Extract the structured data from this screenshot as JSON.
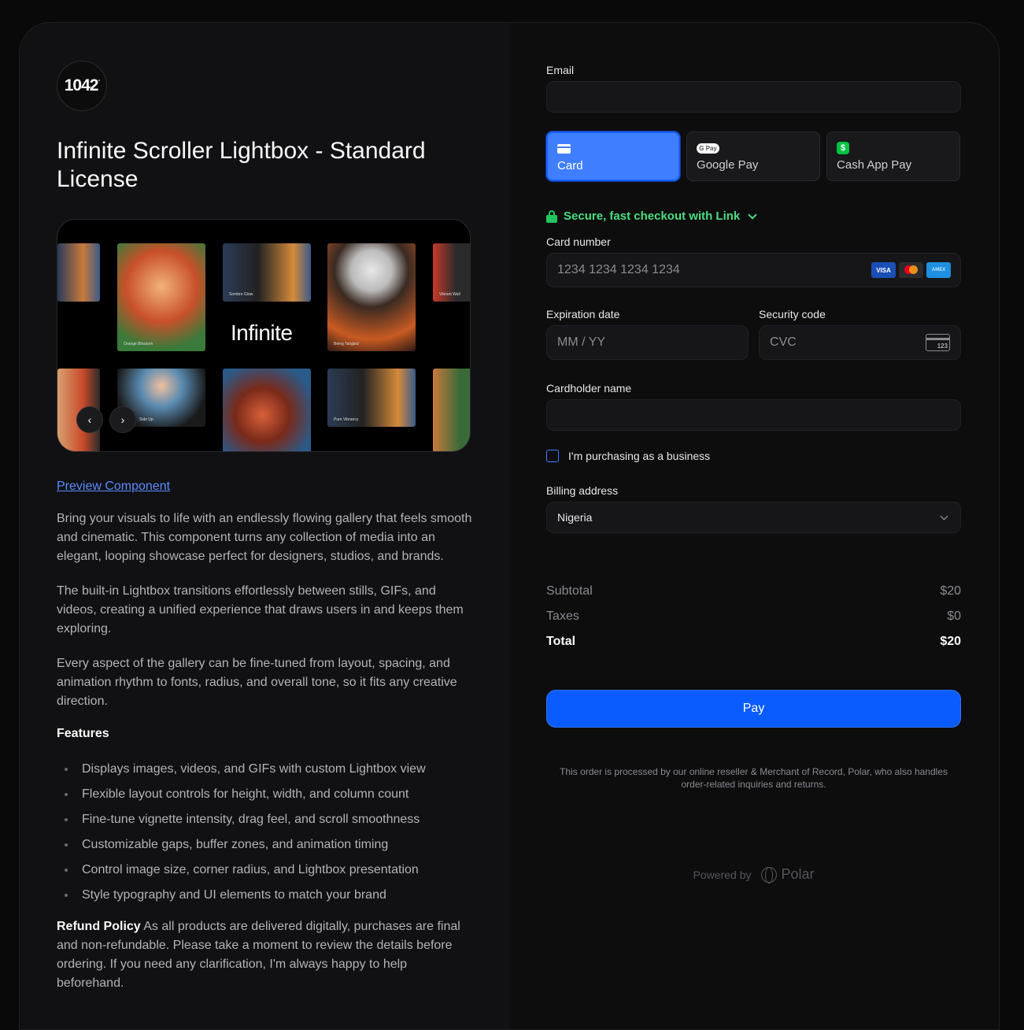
{
  "product": {
    "logo_text": "1042",
    "logo_sup": "°",
    "title": "Infinite Scroller Lightbox - Standard License",
    "gallery": {
      "center_word": "Infinite",
      "captions": [
        "Orange Blossom",
        "Sombre Glow",
        "Being Tangled",
        "Vibrant Wall",
        "Side Up",
        "Pure Vibrancy"
      ],
      "prev_label": "‹",
      "next_label": "›"
    },
    "preview_link": "Preview Component",
    "paragraphs": [
      "Bring your visuals to life with an endlessly flowing gallery that feels smooth and cinematic. This component turns any collection of media into an elegant, looping showcase perfect for designers, studios, and brands.",
      "The built-in Lightbox transitions effortlessly between stills, GIFs, and videos, creating a unified experience that draws users in and keeps them exploring.",
      "Every aspect of the gallery can be fine-tuned from layout, spacing, and animation rhythm to fonts, radius, and overall tone, so it fits any creative direction."
    ],
    "features_title": "Features",
    "features": [
      "Displays images, videos, and GIFs with custom Lightbox view",
      "Flexible layout controls for height, width, and column count",
      "Fine-tune vignette intensity, drag feel, and scroll smoothness",
      "Customizable gaps, buffer zones, and animation timing",
      "Control image size, corner radius, and Lightbox presentation",
      "Style typography and UI elements to match your brand"
    ],
    "refund_title": "Refund Policy",
    "refund_text": " As all products are delivered digitally, purchases are final and non-refundable. Please take a moment to review the details before ordering. If you need any clarification, I'm always happy to help beforehand."
  },
  "checkout": {
    "email_label": "Email",
    "email_value": "",
    "methods": [
      {
        "label": "Card",
        "icon": "card-icon",
        "active": true
      },
      {
        "label": "Google Pay",
        "icon": "google-pay-icon",
        "active": false
      },
      {
        "label": "Cash App Pay",
        "icon": "cash-app-icon",
        "active": false
      }
    ],
    "gpay_badge": "G Pay",
    "cash_badge": "$",
    "link_text": "Secure, fast checkout with Link",
    "card_number_label": "Card number",
    "card_number_placeholder": "1234 1234 1234 1234",
    "brands": [
      {
        "name": "VISA",
        "bg": "#1a4fb5",
        "fg": "#ffffff"
      },
      {
        "name": "",
        "bg": "#2b2b2e",
        "fg": "#ffffff"
      },
      {
        "name": "AMEX",
        "bg": "#1f8fe0",
        "fg": "#bfe6ff"
      }
    ],
    "exp_label": "Expiration date",
    "exp_placeholder": "MM / YY",
    "cvc_label": "Security code",
    "cvc_placeholder": "CVC",
    "cvc_badge": "123",
    "name_label": "Cardholder name",
    "business_label": "I'm purchasing as a business",
    "billing_label": "Billing address",
    "billing_value": "Nigeria",
    "subtotal_label": "Subtotal",
    "subtotal_value": "$20",
    "taxes_label": "Taxes",
    "taxes_value": "$0",
    "total_label": "Total",
    "total_value": "$20",
    "pay_label": "Pay",
    "legal": "This order is processed by our online reseller & Merchant of Record, Polar, who also handles order-related inquiries and returns.",
    "powered_by": "Powered by",
    "polar_word": "Polar"
  },
  "colors": {
    "accent": "#0a5cff",
    "link_green": "#4ade80",
    "panel_left": "#111113",
    "panel_right": "#0d0d0e"
  }
}
